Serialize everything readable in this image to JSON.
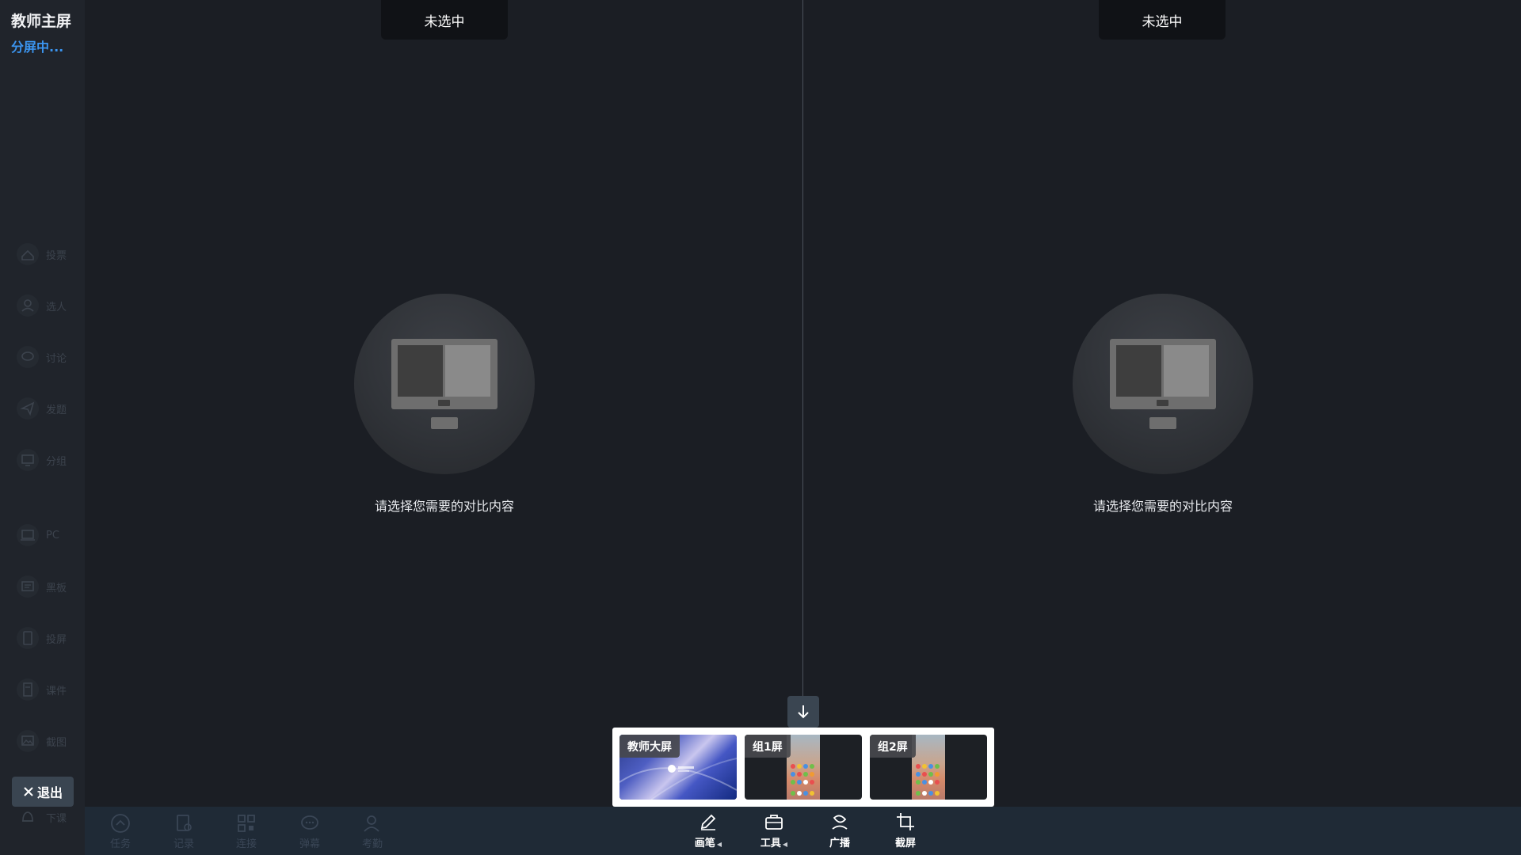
{
  "sidebar": {
    "title": "教师主屏",
    "status": "分屏中...",
    "items": [
      {
        "label": "投票",
        "icon": "vote-icon"
      },
      {
        "label": "选人",
        "icon": "person-icon"
      },
      {
        "label": "讨论",
        "icon": "discussion-icon"
      },
      {
        "label": "发题",
        "icon": "send-icon"
      },
      {
        "label": "分组",
        "icon": "group-screen-icon"
      },
      {
        "label": "PC",
        "icon": "pc-icon"
      },
      {
        "label": "黑板",
        "icon": "blackboard-icon"
      },
      {
        "label": "投屏",
        "icon": "cast-icon"
      },
      {
        "label": "课件",
        "icon": "courseware-icon"
      },
      {
        "label": "截图",
        "icon": "screenshot-icon"
      },
      {
        "label": "下课",
        "icon": "bell-icon"
      }
    ],
    "exit_label": "退出"
  },
  "panes": {
    "left": {
      "tab": "未选中",
      "hint": "请选择您需要的对比内容"
    },
    "right": {
      "tab": "未选中",
      "hint": "请选择您需要的对比内容"
    }
  },
  "thumbnails": [
    {
      "label": "教师大屏"
    },
    {
      "label": "组1屏"
    },
    {
      "label": "组2屏"
    }
  ],
  "bottombar": {
    "dim_items": [
      {
        "label": "任务",
        "icon": "task-icon"
      },
      {
        "label": "记录",
        "icon": "record-icon"
      },
      {
        "label": "连接",
        "icon": "qr-icon"
      },
      {
        "label": "弹幕",
        "icon": "chat-icon"
      },
      {
        "label": "考勤",
        "icon": "attendance-icon"
      }
    ],
    "tools": [
      {
        "label": "画笔",
        "icon": "pen-icon",
        "has_caret": true
      },
      {
        "label": "工具",
        "icon": "toolbox-icon",
        "has_caret": true
      },
      {
        "label": "广播",
        "icon": "broadcast-icon",
        "has_caret": false
      },
      {
        "label": "截屏",
        "icon": "crop-icon",
        "has_caret": false
      }
    ]
  },
  "colors": {
    "background": "#1b1e24",
    "accent": "#3b95f0",
    "tab": "#101216",
    "toolbar": "#1f2a36"
  }
}
